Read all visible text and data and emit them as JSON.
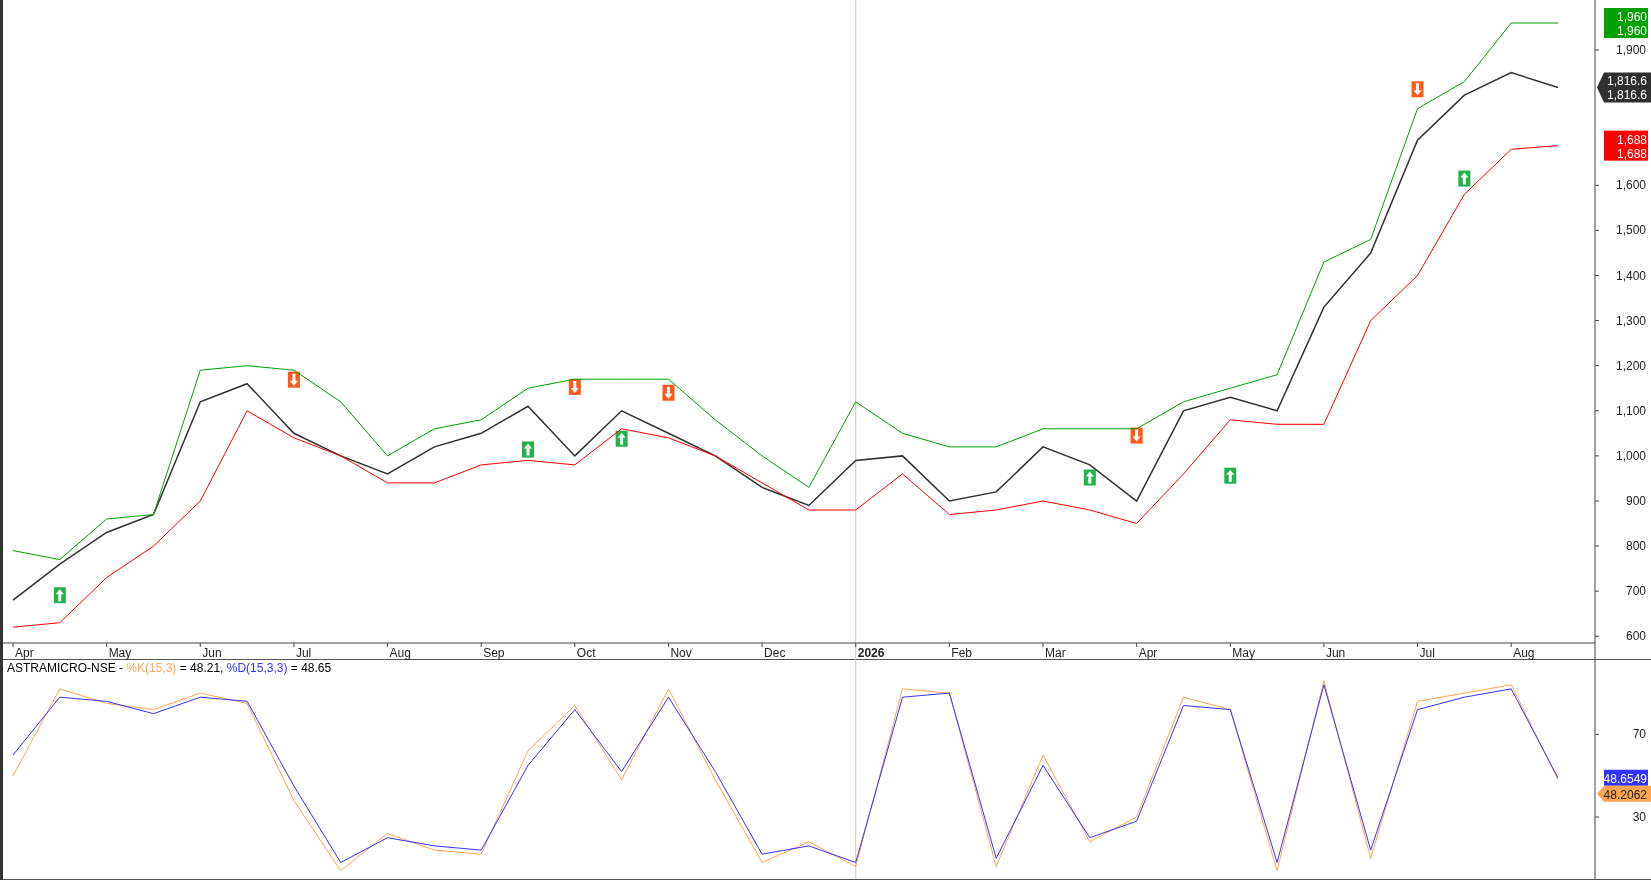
{
  "price_pane": {
    "chart_data": {
      "type": "line",
      "categories": [
        "Apr",
        null,
        "May",
        null,
        "Jun",
        null,
        "Jul",
        null,
        "Aug",
        null,
        "Sep",
        null,
        "Oct",
        null,
        "Nov",
        null,
        "Dec",
        null,
        "2026",
        null,
        "Feb",
        null,
        "Mar",
        null,
        "Apr",
        null,
        "May",
        null,
        "Jun",
        null,
        "Jul",
        null,
        "Aug",
        null
      ],
      "series": [
        {
          "color": "#303030",
          "values": [
            680,
            760,
            830,
            870,
            1120,
            1160,
            1050,
            1000,
            960,
            1020,
            1050,
            1110,
            1000,
            1100,
            1050,
            1000,
            930,
            890,
            990,
            1000,
            900,
            920,
            1020,
            980,
            900,
            1100,
            1130,
            1100,
            1330,
            1450,
            1700,
            1800,
            1850,
            1817
          ]
        },
        {
          "color": "#00a000",
          "values": [
            790,
            770,
            860,
            870,
            1190,
            1200,
            1190,
            1120,
            1000,
            1060,
            1080,
            1150,
            1170,
            1170,
            1170,
            1080,
            1000,
            930,
            1120,
            1050,
            1020,
            1020,
            1060,
            1060,
            1060,
            1120,
            1150,
            1180,
            1430,
            1480,
            1770,
            1830,
            1960,
            1960
          ]
        },
        {
          "color": "#ff0000",
          "values": [
            620,
            630,
            730,
            800,
            900,
            1100,
            1040,
            1000,
            940,
            940,
            980,
            990,
            980,
            1060,
            1040,
            1000,
            940,
            880,
            880,
            960,
            870,
            880,
            900,
            880,
            850,
            960,
            1080,
            1070,
            1070,
            1300,
            1400,
            1580,
            1680,
            1688
          ]
        },
        {
          "type": "scatter",
          "color": "#22b14c",
          "values": [
            null,
            691,
            null,
            null,
            null,
            null,
            null,
            null,
            null,
            null,
            null,
            1014,
            null,
            1038,
            null,
            null,
            null,
            null,
            null,
            null,
            null,
            null,
            null,
            952,
            null,
            null,
            956,
            null,
            null,
            null,
            null,
            1615,
            null,
            null
          ]
        },
        {
          "type": "scatter",
          "color": "#ff5a1a",
          "values": [
            null,
            null,
            null,
            null,
            null,
            null,
            1169,
            null,
            null,
            null,
            null,
            null,
            1153,
            null,
            1140,
            null,
            null,
            null,
            null,
            null,
            null,
            null,
            null,
            null,
            1045,
            null,
            null,
            null,
            null,
            null,
            1813,
            null,
            null,
            null
          ]
        }
      ],
      "ylim": [
        585,
        2011
      ],
      "yticks": [
        {
          "value": 600,
          "label": "600"
        },
        {
          "value": 700,
          "label": "700"
        },
        {
          "value": 800,
          "label": "800"
        },
        {
          "value": 900,
          "label": "900"
        },
        {
          "value": 1000,
          "label": "1,000"
        },
        {
          "value": 1100,
          "label": "1,100"
        },
        {
          "value": 1200,
          "label": "1,200"
        },
        {
          "value": 1300,
          "label": "1,300"
        },
        {
          "value": 1400,
          "label": "1,400"
        },
        {
          "value": 1500,
          "label": "1,500"
        },
        {
          "value": 1600,
          "label": "1,600"
        },
        {
          "value": 1900,
          "label": "1,900"
        }
      ],
      "annotations": [
        "1,960",
        "1,960",
        "1,816.6",
        "1,816.6",
        "1,688",
        "1,688"
      ]
    }
  },
  "osc_pane": {
    "legend": {
      "ticker": "ASTRAMICRO-NSE - ",
      "values": [
        " = 48.21, ",
        " = 48.65"
      ]
    },
    "chart_data": {
      "type": "line",
      "series": [
        {
          "name": "%K(15,3)",
          "color": "#ffa54f",
          "values": [
            50,
            92,
            85,
            82,
            90,
            85,
            38,
            4,
            22,
            14,
            12,
            62,
            84,
            48,
            92,
            48,
            8,
            18,
            6,
            92,
            90,
            6,
            60,
            18,
            30,
            88,
            82,
            4,
            96,
            10,
            86,
            90,
            94,
            48
          ]
        },
        {
          "name": "%D(15,3,3)",
          "color": "#3333ff",
          "values": [
            60,
            88,
            86,
            80,
            88,
            86,
            45,
            8,
            20,
            16,
            14,
            55,
            82,
            52,
            88,
            52,
            12,
            16,
            8,
            88,
            90,
            10,
            55,
            20,
            28,
            84,
            82,
            8,
            94,
            14,
            82,
            88,
            92,
            49
          ]
        }
      ],
      "ylim": [
        0,
        106
      ],
      "yticks": [
        {
          "value": 30,
          "label": "30"
        },
        {
          "value": 70,
          "label": "70"
        }
      ],
      "annotations": [
        "48.6549",
        "48.2062"
      ]
    }
  }
}
